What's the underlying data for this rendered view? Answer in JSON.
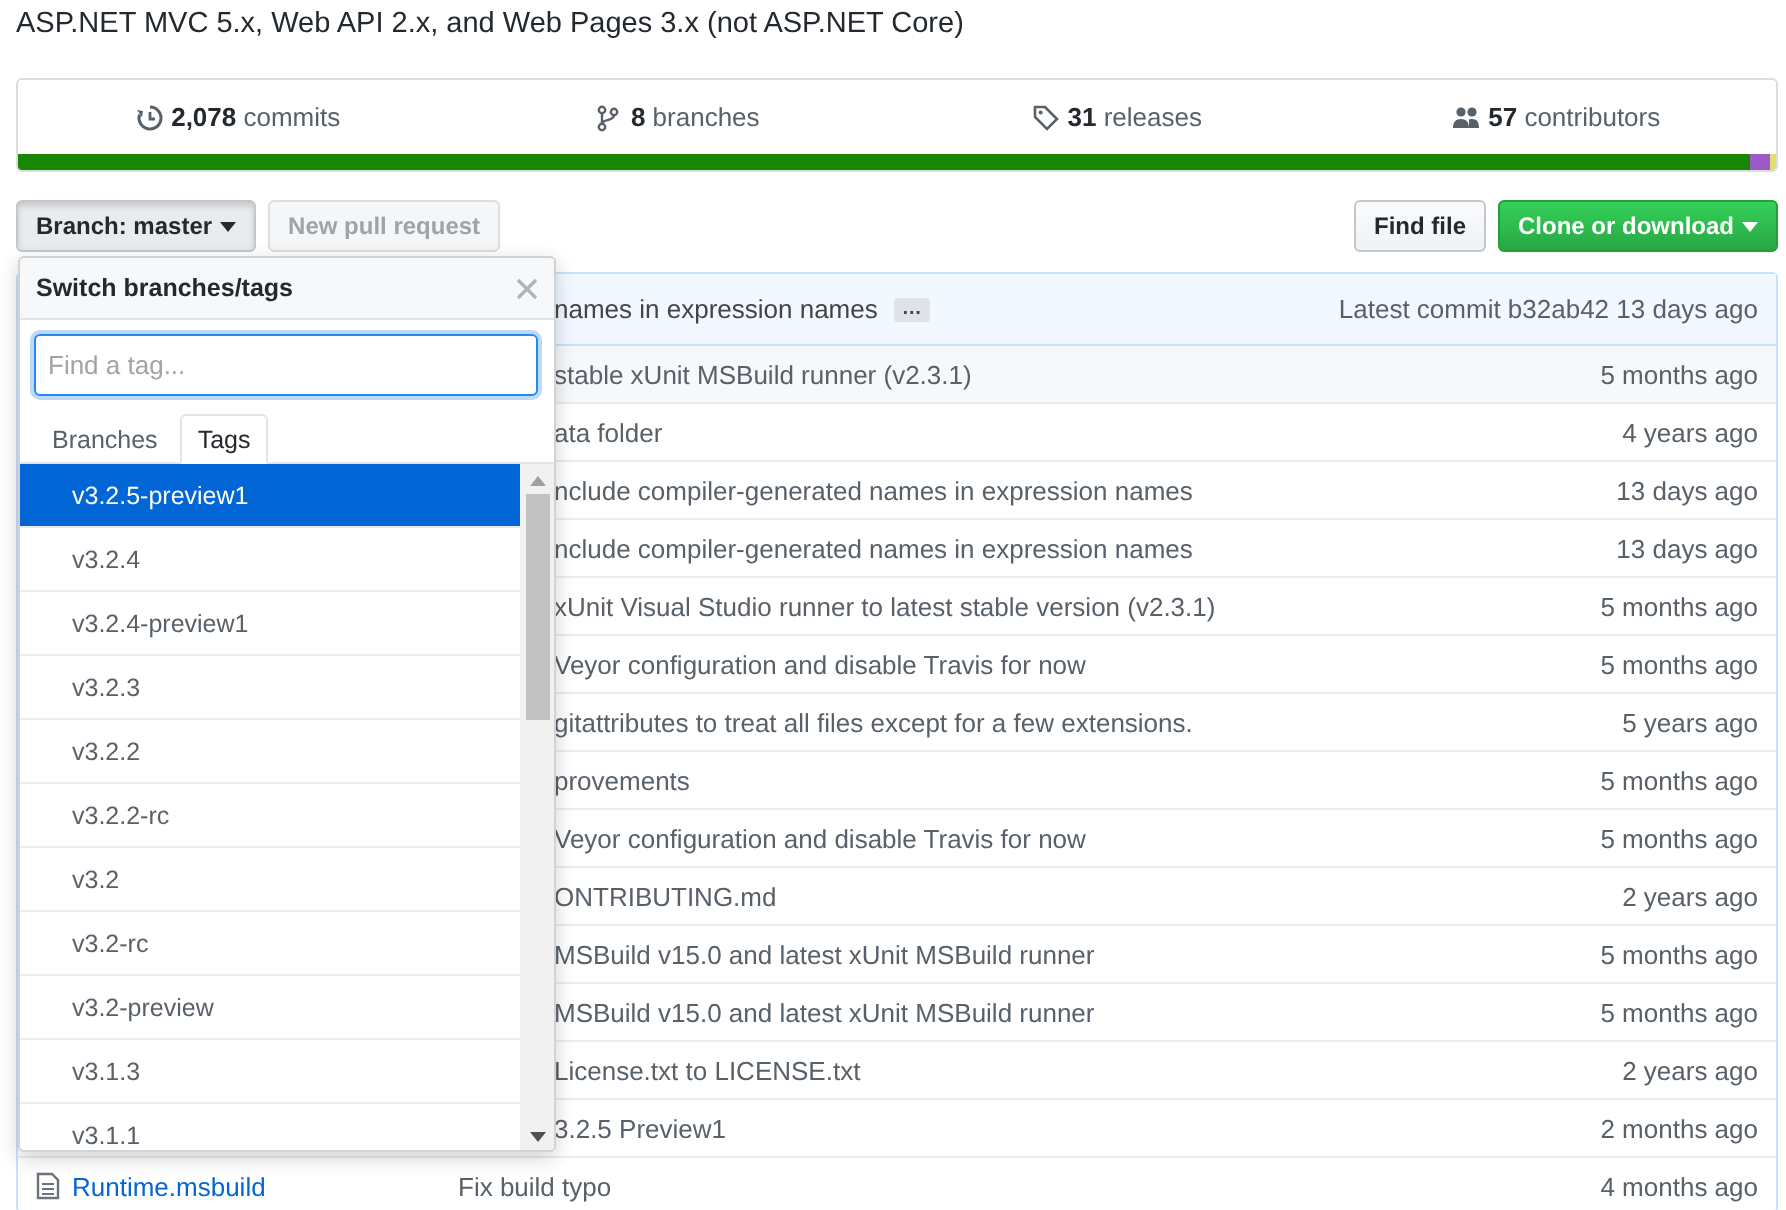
{
  "description": "ASP.NET MVC 5.x, Web API 2.x, and Web Pages 3.x (not ASP.NET Core)",
  "stats": [
    {
      "kind": "commits",
      "count": "2,078",
      "label": "commits"
    },
    {
      "kind": "branches",
      "count": "8",
      "label": "branches"
    },
    {
      "kind": "releases",
      "count": "31",
      "label": "releases"
    },
    {
      "kind": "contributors",
      "count": "57",
      "label": "contributors"
    }
  ],
  "languages": [
    {
      "color": "#178600",
      "level": 0.985
    },
    {
      "color": "#9b59c9",
      "level": 0.012
    },
    {
      "color": "#e0e070",
      "level": 0.003
    }
  ],
  "branch_button": "Branch: master",
  "new_pull_request": {
    "label": "New pull request",
    "disabled": true
  },
  "find_file": "Find file",
  "clone_button": "Clone or download",
  "latest_commit": {
    "message": "names in expression names",
    "ellipsis": "…",
    "label": "Latest commit",
    "sha": "b32ab42",
    "age": "13 days ago"
  },
  "files": [
    {
      "message": "stable xUnit MSBuild runner (v2.3.1)",
      "age": "5 months ago"
    },
    {
      "message": "ata folder",
      "age": "4 years ago"
    },
    {
      "message": "nclude compiler-generated names in expression names",
      "age": "13 days ago"
    },
    {
      "message": "nclude compiler-generated names in expression names",
      "age": "13 days ago"
    },
    {
      "message": "xUnit Visual Studio runner to latest stable version (v2.3.1)",
      "age": "5 months ago"
    },
    {
      "message": "Veyor configuration and disable Travis for now",
      "age": "5 months ago"
    },
    {
      "message": "gitattributes to treat all files except for a few extensions.",
      "age": "5 years ago"
    },
    {
      "message": "provements",
      "age": "5 months ago"
    },
    {
      "message": "Veyor configuration and disable Travis for now",
      "age": "5 months ago"
    },
    {
      "message": "ONTRIBUTING.md",
      "age": "2 years ago"
    },
    {
      "message": "MSBuild v15.0 and latest xUnit MSBuild runner",
      "age": "5 months ago"
    },
    {
      "message": "MSBuild v15.0 and latest xUnit MSBuild runner",
      "age": "5 months ago"
    },
    {
      "message": "License.txt to LICENSE.txt",
      "age": "2 years ago"
    },
    {
      "message": "3.2.5 Preview1",
      "age": "2 months ago"
    },
    {
      "name": "Runtime.msbuild",
      "message": "Fix build typo",
      "age": "4 months ago"
    }
  ],
  "dropdown": {
    "title": "Switch branches/tags",
    "filter": {
      "placeholder": "Find a tag..."
    },
    "tabs": [
      {
        "label": "Branches",
        "selected": false
      },
      {
        "label": "Tags",
        "selected": true
      }
    ],
    "items": [
      {
        "label": "v3.2.5-preview1",
        "selected": true
      },
      {
        "label": "v3.2.4",
        "selected": false
      },
      {
        "label": "v3.2.4-preview1",
        "selected": false
      },
      {
        "label": "v3.2.3",
        "selected": false
      },
      {
        "label": "v3.2.2",
        "selected": false
      },
      {
        "label": "v3.2.2-rc",
        "selected": false
      },
      {
        "label": "v3.2",
        "selected": false
      },
      {
        "label": "v3.2-rc",
        "selected": false
      },
      {
        "label": "v3.2-preview",
        "selected": false
      },
      {
        "label": "v3.1.3",
        "selected": false
      },
      {
        "label": "v3.1.1",
        "selected": false
      }
    ]
  }
}
